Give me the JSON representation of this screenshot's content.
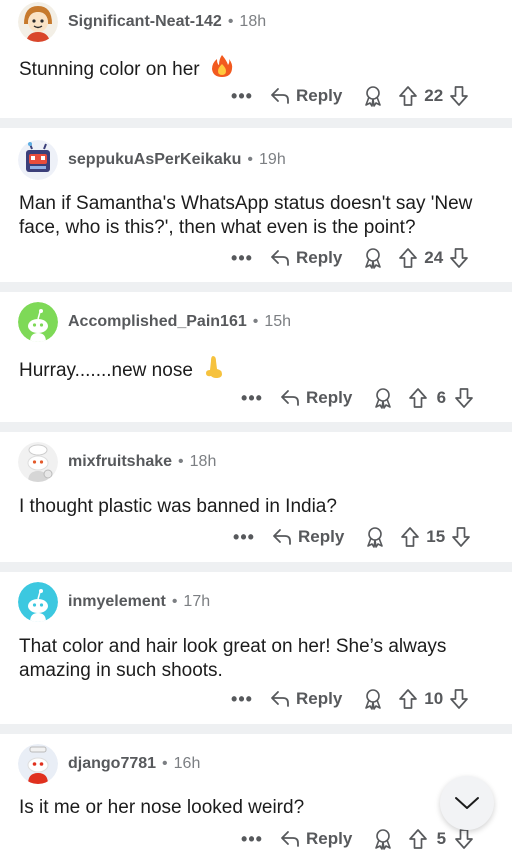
{
  "comments": [
    {
      "username": "Significant-Neat-142",
      "time": "18h",
      "text": "Stunning color on her",
      "emoji": "fire",
      "reply_label": "Reply",
      "votes": "22",
      "avatar": "girl-avatar-icon"
    },
    {
      "username": "seppukuAsPerKeikaku",
      "time": "19h",
      "text": "Man if Samantha's WhatsApp status doesn't say 'New face, who is this?', then what even is the point?",
      "reply_label": "Reply",
      "votes": "24",
      "avatar": "robot-avatar-icon"
    },
    {
      "username": "Accomplished_Pain161",
      "time": "15h",
      "text": "Hurray.......new nose",
      "emoji": "nose",
      "reply_label": "Reply",
      "votes": "6",
      "avatar": "green-snoo-avatar-icon"
    },
    {
      "username": "mixfruitshake",
      "time": "18h",
      "text": "I thought plastic was banned in India?",
      "reply_label": "Reply",
      "votes": "15",
      "avatar": "chef-snoo-avatar-icon"
    },
    {
      "username": "inmyelement",
      "time": "17h",
      "text": "That color and hair look great on her! She’s always amazing in such shoots.",
      "reply_label": "Reply",
      "votes": "10",
      "avatar": "blue-snoo-avatar-icon"
    },
    {
      "username": "django7781",
      "time": "16h",
      "text": "Is it me or her nose looked weird?",
      "reply_label": "Reply",
      "votes": "5",
      "avatar": "red-snoo-avatar-icon"
    }
  ],
  "separator": "•",
  "more_label": "•••",
  "colors": {
    "text_primary": "#1c1c1c",
    "text_secondary": "#57595c",
    "divider": "#eef0f2"
  }
}
